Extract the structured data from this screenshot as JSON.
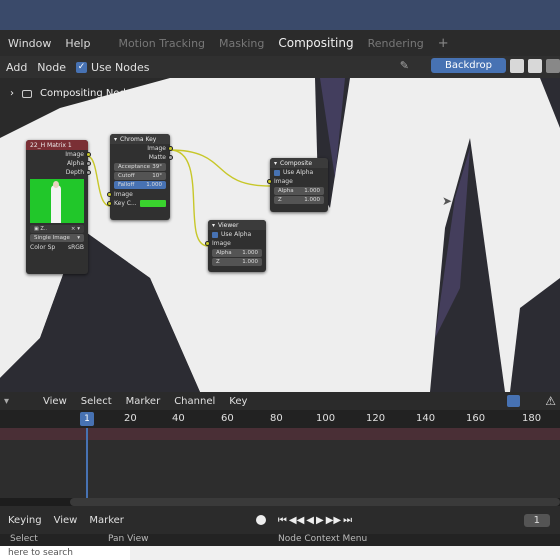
{
  "menubar": {
    "items": [
      "Window",
      "Help"
    ],
    "workspaces": [
      "Motion Tracking",
      "Masking",
      "Compositing",
      "Rendering"
    ],
    "active_workspace": "Compositing",
    "add_tab": "+"
  },
  "header": {
    "add": "Add",
    "node": "Node",
    "use_nodes": "Use Nodes",
    "backdrop": "Backdrop"
  },
  "breadcrumb": {
    "label": "Compositing Nodetree"
  },
  "nodes": {
    "movie": {
      "title": "22_H Matrix 1",
      "outputs": [
        "Image",
        "Alpha",
        "Depth"
      ],
      "source": "Single Image",
      "colorspace_label": "Color Sp",
      "colorspace": "sRGB"
    },
    "chroma": {
      "title": "Chroma Key",
      "outputs": [
        "Image",
        "Matte"
      ],
      "acceptance_label": "Acceptance",
      "acceptance": "39°",
      "cutoff_label": "Cutoff",
      "cutoff": "10°",
      "falloff_label": "Falloff",
      "falloff": "1.000",
      "inputs": [
        "Image",
        "Key C..."
      ]
    },
    "composite": {
      "title": "Composite",
      "use_alpha": "Use Alpha",
      "input": "Image",
      "alpha_label": "Alpha",
      "alpha": "1.000",
      "z_label": "Z",
      "z": "1.000"
    },
    "viewer": {
      "title": "Viewer",
      "use_alpha": "Use Alpha",
      "input": "Image",
      "alpha_label": "Alpha",
      "alpha": "1.000",
      "z_label": "Z",
      "z": "1.000"
    }
  },
  "timeline": {
    "menu": [
      "View",
      "Select",
      "Marker",
      "Channel",
      "Key"
    ],
    "current_frame": "1",
    "ticks": [
      "20",
      "40",
      "60",
      "80",
      "100",
      "120",
      "140",
      "160",
      "180"
    ],
    "footer": [
      "Keying",
      "View",
      "Marker"
    ],
    "frame_field": "1"
  },
  "status": {
    "select": "Select",
    "pan": "Pan View",
    "context": "Node Context Menu"
  },
  "taskbar": {
    "search_placeholder": "here to search"
  },
  "colors": {
    "accent": "#4772b3",
    "socket_yellow": "#c7c729",
    "node_header_red": "#7a2f35",
    "key_color": "#3ad32e",
    "green_screen": "#21c72a"
  }
}
